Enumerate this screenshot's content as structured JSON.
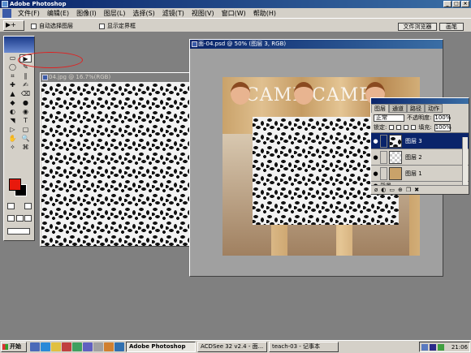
{
  "window": {
    "title": "Adobe Photoshop",
    "controls": [
      "_",
      "□",
      "×"
    ]
  },
  "menu": [
    "文件(F)",
    "编辑(E)",
    "图像(I)",
    "图层(L)",
    "选择(S)",
    "滤镜(T)",
    "视图(V)",
    "窗口(W)",
    "帮助(H)"
  ],
  "options": {
    "tool_glyph": "▶+",
    "auto_select": "自动选择图层",
    "show_bounds": "显示定界框",
    "palette_wells": [
      "文件浏览器",
      "画笔"
    ]
  },
  "tools": [
    "▭",
    "▶",
    "◯",
    "✎",
    "⌗",
    "∥",
    "✚",
    "✍",
    "▲",
    "⌫",
    "◆",
    "●",
    "◐",
    "◉",
    "◥",
    "T",
    "▷",
    "▢",
    "✋",
    "🔍",
    "✧",
    "⌘"
  ],
  "colors": {
    "foreground": "#e8190c",
    "background": "#000000"
  },
  "documents": [
    {
      "title": "04.jpg @ 16.7%(RGB)"
    },
    {
      "title": "面-04.psd @ 50% (图层 3, RGB)"
    }
  ],
  "photo_text": [
    "CAME",
    "CAMEA"
  ],
  "layers_panel": {
    "tabs": [
      "图层",
      "通道",
      "路径",
      "动作"
    ],
    "blend_mode": "正常",
    "opacity_label": "不透明度:",
    "opacity": "100%",
    "lock_label": "锁定:",
    "fill_label": "填充:",
    "fill": "100%",
    "layers": [
      {
        "name": "图层 3",
        "selected": true
      },
      {
        "name": "图层 2",
        "selected": false
      },
      {
        "name": "图层 1",
        "selected": false
      },
      {
        "name": "背景",
        "selected": false
      }
    ],
    "bottom_icons": [
      "ø",
      "◐",
      "▭",
      "⊕",
      "❐",
      "✖"
    ]
  },
  "taskbar": {
    "start": "开始",
    "tasks": [
      "Adobe Photoshop",
      "ACDSee 32 v2.4 - 面...",
      "teach-03 - 记事本"
    ],
    "clock": "21:06"
  }
}
